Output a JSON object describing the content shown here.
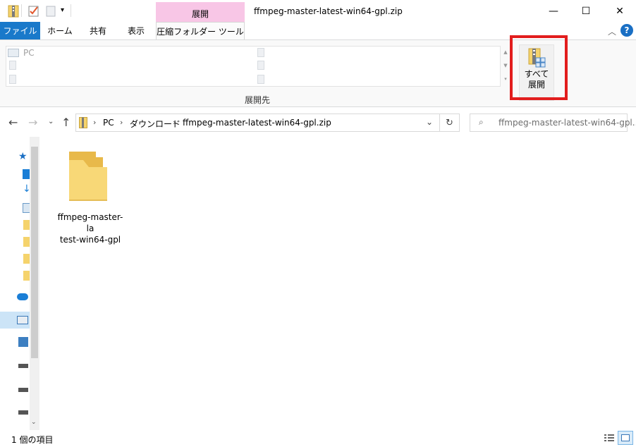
{
  "window": {
    "title": "ffmpeg-master-latest-win64-gpl.zip",
    "context_tab_header": "展開",
    "minimize": "—",
    "maximize": "☐",
    "close": "✕"
  },
  "ribbon_tabs": {
    "file": "ファイル",
    "home": "ホーム",
    "share": "共有",
    "view": "表示",
    "tools": "圧縮フォルダー ツール"
  },
  "ribbon": {
    "gallery_first_item": "PC",
    "extract_all_label_line1": "すべて",
    "extract_all_label_line2": "展開",
    "group_label": "展開先",
    "help": "?",
    "collapse": "︿"
  },
  "address": {
    "crumbs": [
      "PC",
      "ダウンロード",
      "ffmpeg-master-latest-win64-gpl.zip"
    ],
    "search_placeholder": "ffmpeg-master-latest-win64-gpl...."
  },
  "content": {
    "items": [
      {
        "name": "ffmpeg-master-latest-win64-gpl",
        "name_line1": "ffmpeg-master-la",
        "name_line2": "test-win64-gpl"
      }
    ]
  },
  "status": {
    "item_count": "1 個の項目"
  },
  "colors": {
    "file_tab": "#1979ca",
    "context_tab": "#f8c6e6",
    "highlight": "#e21d1d",
    "folder": "#f5d36c"
  }
}
